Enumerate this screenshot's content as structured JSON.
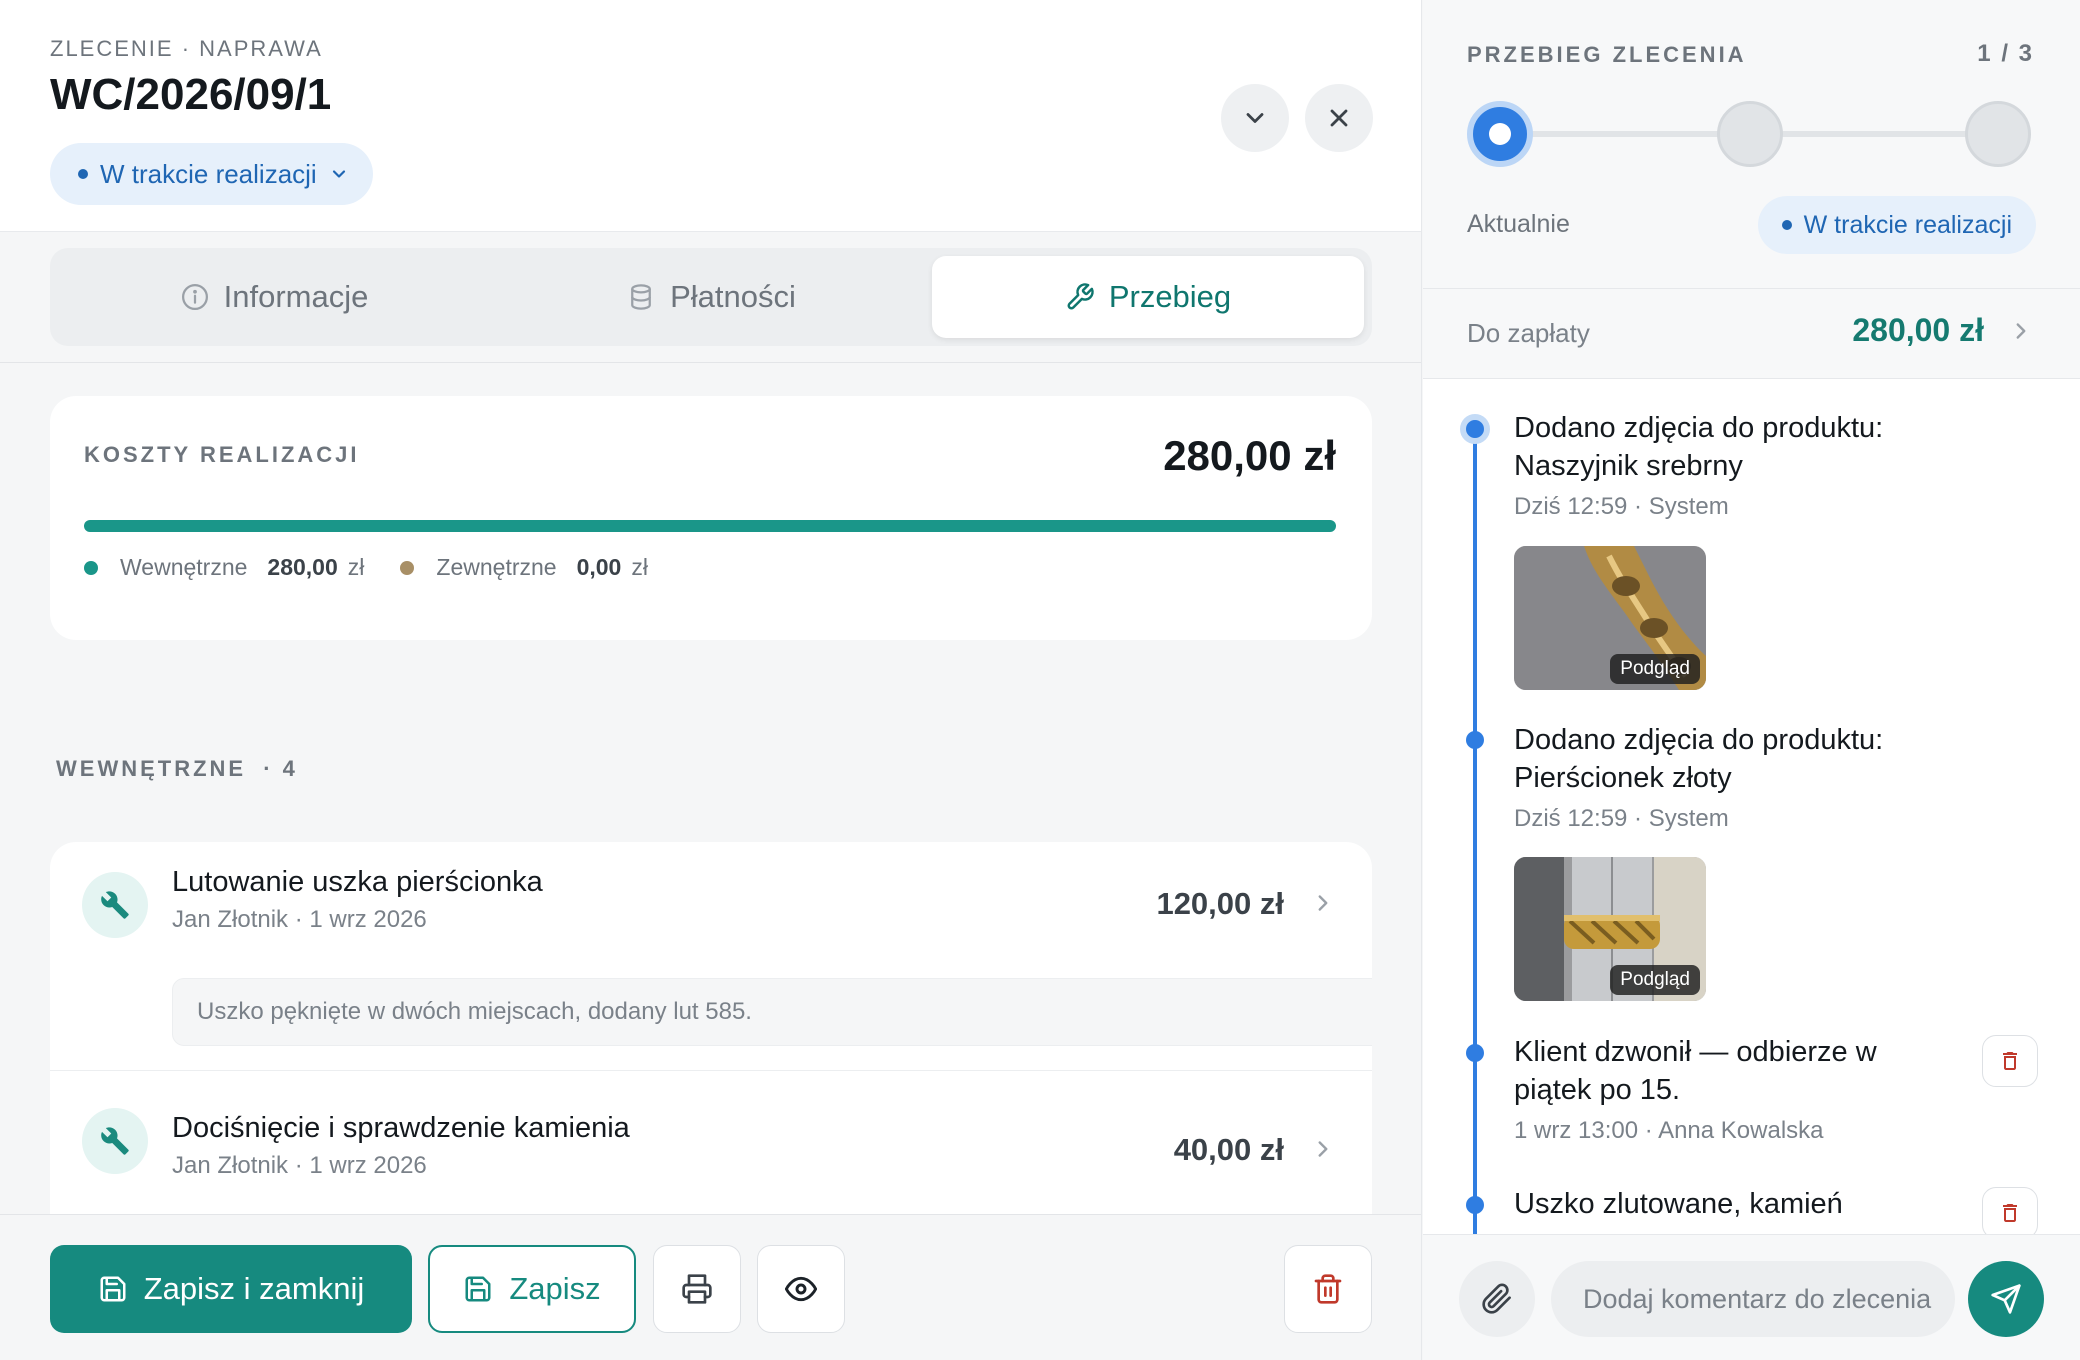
{
  "header": {
    "breadcrumb": "ZLECENIE · NAPRAWA",
    "order_number": "WC/2026/09/1",
    "status_label": "W trakcie realizacji"
  },
  "tabs": [
    {
      "label": "Informacje",
      "icon": "info-icon",
      "active": false
    },
    {
      "label": "Płatności",
      "icon": "database-icon",
      "active": false
    },
    {
      "label": "Przebieg",
      "icon": "wrench-icon",
      "active": true
    }
  ],
  "costs": {
    "label": "KOSZTY REALIZACJI",
    "total": "280,00 zł",
    "internal_share": 1.0,
    "internal_label": "Wewnętrzne",
    "internal_value": "280,00",
    "external_label": "Zewnętrzne",
    "external_value": "0,00",
    "currency": "zł"
  },
  "internal_section": {
    "label": "WEWNĘTRZNE",
    "count": "· 4"
  },
  "items": [
    {
      "title": "Lutowanie uszka pierścionka",
      "meta": "Jan Złotnik · 1 wrz 2026",
      "price": "120,00 zł",
      "note": "Uszko pęknięte w dwóch miejscach, dodany lut 585."
    },
    {
      "title": "Dociśnięcie i sprawdzenie kamienia",
      "meta": "Jan Złotnik · 1 wrz 2026",
      "price": "40,00 zł"
    }
  ],
  "footer": {
    "save_close_label": "Zapisz i zamknij",
    "save_label": "Zapisz"
  },
  "progress": {
    "label": "PRZEBIEG ZLECENIA",
    "counter": "1 / 3",
    "current_step": 1,
    "total_steps": 3,
    "now_label": "Aktualnie",
    "status_label": "W trakcie realizacji"
  },
  "due": {
    "label": "Do zapłaty",
    "value": "280,00 zł"
  },
  "timeline": [
    {
      "title": "Dodano zdjęcia do produktu: Naszyjnik srebrny",
      "meta": "Dziś 12:59 · System",
      "thumb_badge": "Podgląd"
    },
    {
      "title": "Dodano zdjęcia do produktu: Pierścionek złoty",
      "meta": "Dziś 12:59 · System",
      "thumb_badge": "Podgląd"
    },
    {
      "title": "Klient dzwonił — odbierze w piątek po 15.",
      "meta": "1 wrz 13:00 · Anna Kowalska"
    },
    {
      "title": "Uszko zlutowane, kamień"
    }
  ],
  "composer": {
    "placeholder": "Dodaj komentarz do zlecenia"
  },
  "colors": {
    "accent": "#168a7f",
    "status_blue": "#1f66b3",
    "timeline_blue": "#2f7de1",
    "danger": "#c0392b"
  }
}
